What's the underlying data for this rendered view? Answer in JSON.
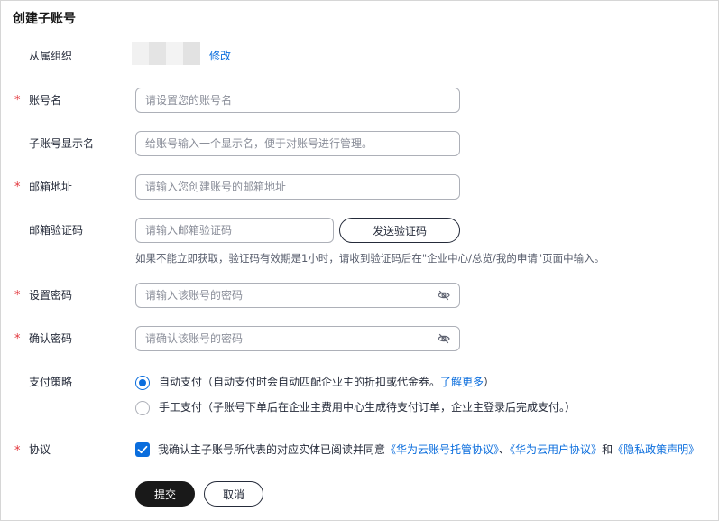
{
  "page_title": "创建子账号",
  "colors": {
    "accent": "#0a6ddd",
    "required": "#e2343a",
    "primary_button": "#191919"
  },
  "organization": {
    "label": "从属组织",
    "edit_link": "修改"
  },
  "account_name": {
    "label": "账号名",
    "placeholder": "请设置您的账号名"
  },
  "display_name": {
    "label": "子账号显示名",
    "placeholder": "给账号输入一个显示名，便于对账号进行管理。"
  },
  "email": {
    "label": "邮箱地址",
    "placeholder": "请输入您创建账号的邮箱地址"
  },
  "email_code": {
    "label": "邮箱验证码",
    "placeholder": "请输入邮箱验证码",
    "send_button": "发送验证码",
    "hint": "如果不能立即获取，验证码有效期是1小时，请收到验证码后在\"企业中心/总览/我的申请\"页面中输入。"
  },
  "password": {
    "label": "设置密码",
    "placeholder": "请输入该账号的密码",
    "toggle_icon": "eye-slash-icon"
  },
  "confirm_password": {
    "label": "确认密码",
    "placeholder": "请确认该账号的密码",
    "toggle_icon": "eye-slash-icon"
  },
  "payment": {
    "label": "支付策略",
    "options": [
      {
        "title": "自动支付",
        "desc": "（自动支付时会自动匹配企业主的折扣或代金券。",
        "link": "了解更多",
        "suffix": "）",
        "selected": true
      },
      {
        "title": "手工支付",
        "desc": "（子账号下单后在企业主费用中心生成待支付订单，企业主登录后完成支付。）",
        "selected": false
      }
    ]
  },
  "agreement": {
    "label": "协议",
    "checked": true,
    "text": "我确认主子账号所代表的对应实体已阅读并同意",
    "link1": "《华为云账号托管协议》",
    "sep1": "、",
    "link2": "《华为云用户协议》",
    "sep2": "和",
    "link3": "《隐私政策声明》"
  },
  "actions": {
    "submit": "提交",
    "cancel": "取消"
  }
}
